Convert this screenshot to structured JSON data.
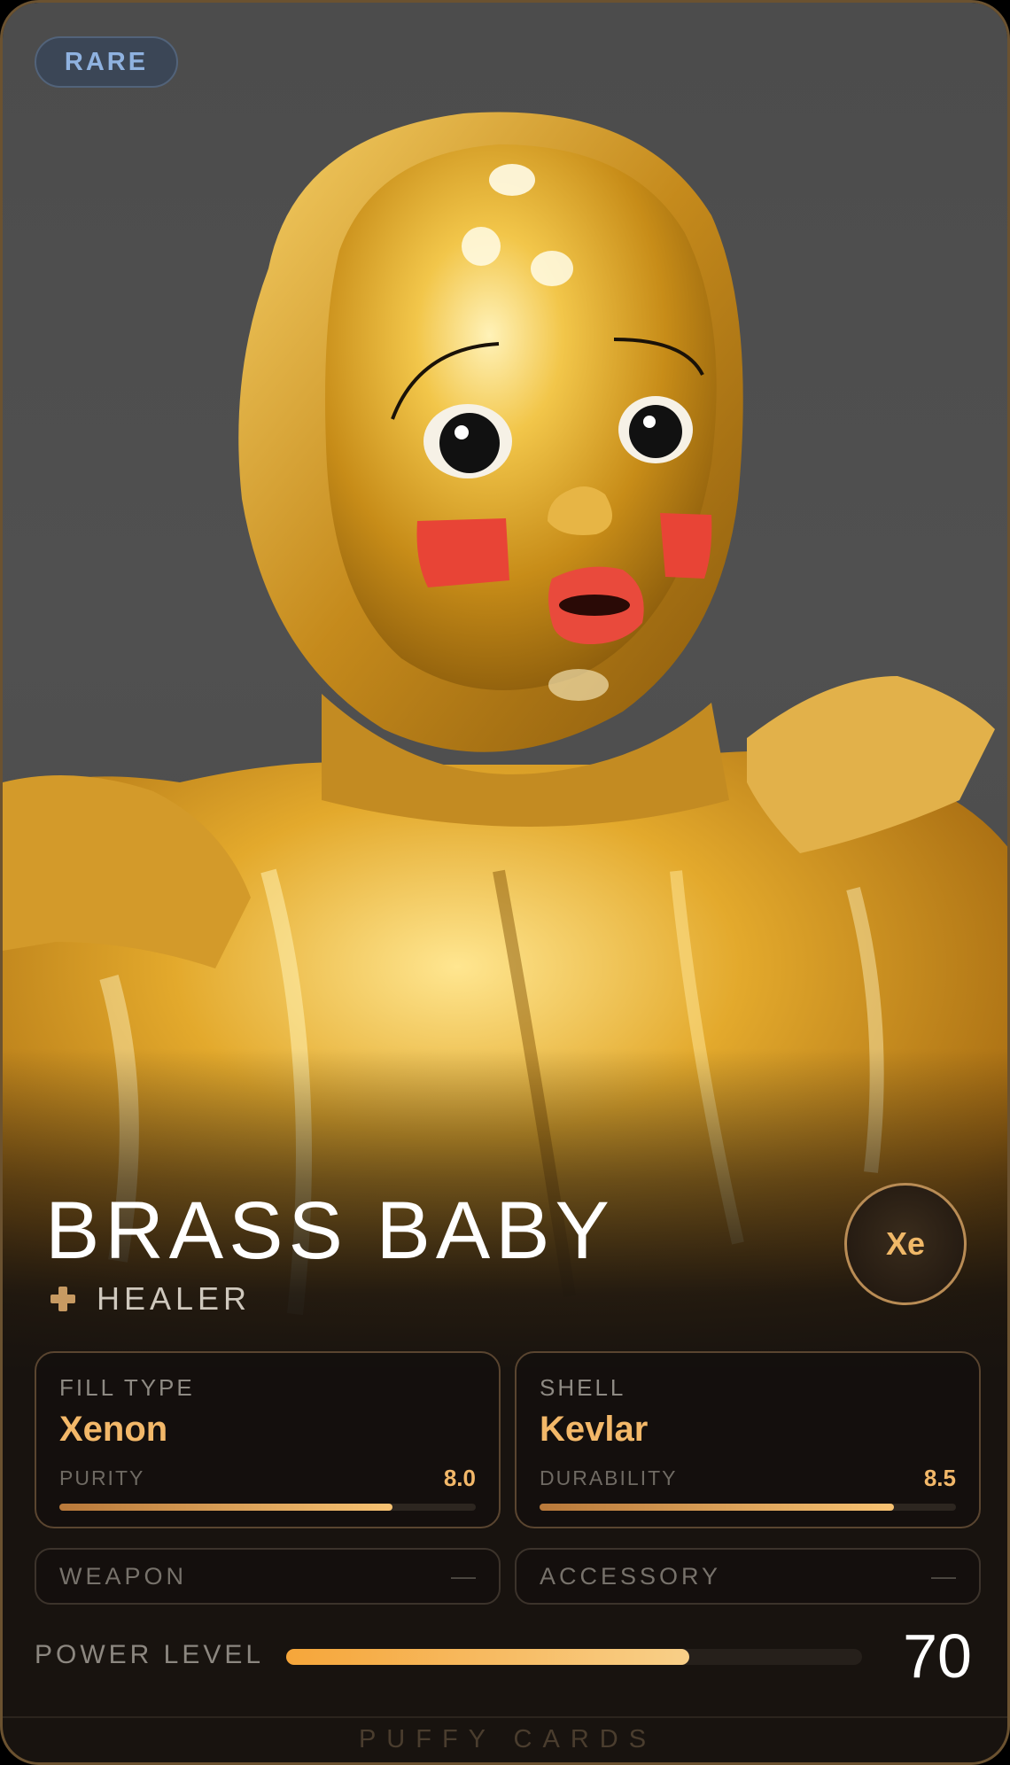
{
  "card": {
    "rarity": "RARE",
    "name": "BRASS BABY",
    "role": "HEALER",
    "role_icon": "cross-icon",
    "element": "Xe",
    "accent_color": "#f3b869",
    "rarity_color": "#8fb2e0"
  },
  "stats": {
    "fill": {
      "label": "FILL TYPE",
      "value": "Xenon",
      "metric_label": "PURITY",
      "metric_value": "8.0",
      "fraction": 0.8
    },
    "shell": {
      "label": "SHELL",
      "value": "Kevlar",
      "metric_label": "DURABILITY",
      "metric_value": "8.5",
      "fraction": 0.85
    }
  },
  "slots": {
    "weapon": {
      "label": "WEAPON",
      "value": "—"
    },
    "accessory": {
      "label": "ACCESSORY",
      "value": "—"
    }
  },
  "power": {
    "label": "POWER LEVEL",
    "value": "70",
    "fraction": 0.7
  },
  "footer": {
    "brand": "PUFFY CARDS"
  }
}
